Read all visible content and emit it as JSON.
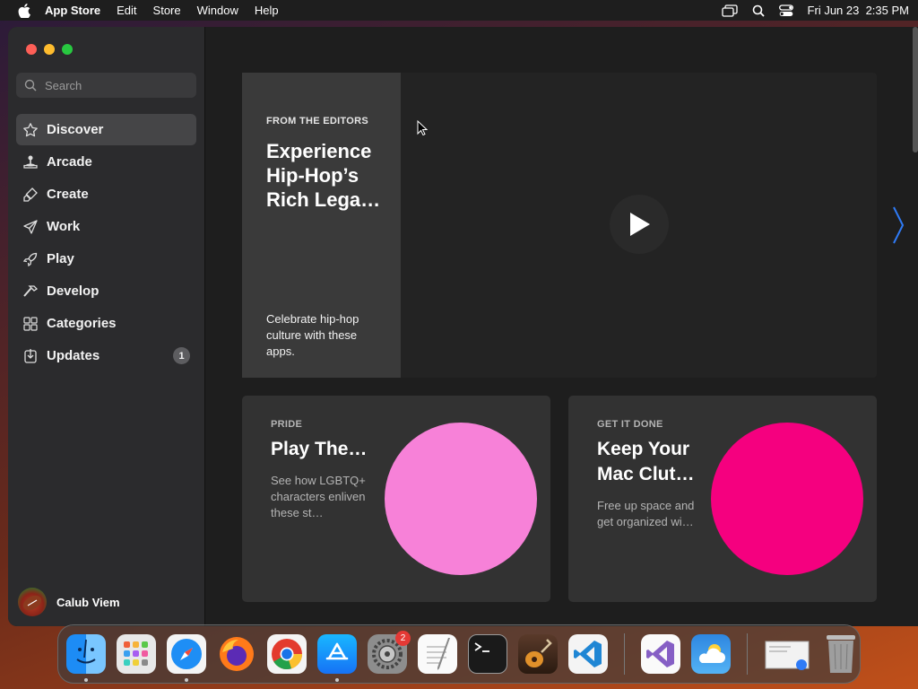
{
  "menubar": {
    "app_name": "App Store",
    "menus": [
      "Edit",
      "Store",
      "Window",
      "Help"
    ],
    "datetime": "Fri Jun 23  2:35 PM",
    "icons": [
      "screen-mirroring-icon",
      "search-icon",
      "control-center-icon"
    ]
  },
  "sidebar": {
    "search_placeholder": "Search",
    "items": [
      {
        "label": "Discover",
        "icon": "star-icon",
        "active": true
      },
      {
        "label": "Arcade",
        "icon": "joystick-icon"
      },
      {
        "label": "Create",
        "icon": "brush-icon"
      },
      {
        "label": "Work",
        "icon": "paper-plane-icon"
      },
      {
        "label": "Play",
        "icon": "rocket-icon"
      },
      {
        "label": "Develop",
        "icon": "hammer-icon"
      },
      {
        "label": "Categories",
        "icon": "grid-icon"
      },
      {
        "label": "Updates",
        "icon": "download-icon",
        "badge": "1"
      }
    ],
    "user_name": "Calub Viem"
  },
  "hero": {
    "eyebrow": "FROM THE EDITORS",
    "title": "Experience Hip-Hop’s Rich Lega…",
    "description": "Celebrate hip-hop culture with these apps."
  },
  "cards": [
    {
      "eyebrow": "PRIDE",
      "title": "Play The…",
      "description": "See how LGBTQ+ characters enliven these st…",
      "color": "#f781d8"
    },
    {
      "eyebrow": "GET IT DONE",
      "title": "Keep Your Mac Clut…",
      "description": "Free up space and get organized wi…",
      "color": "#f5007f"
    }
  ],
  "dock": {
    "settings_badge": "2",
    "apps": [
      "finder-icon",
      "launchpad-icon",
      "safari-icon",
      "firefox-icon",
      "chrome-icon",
      "app-store-icon",
      "system-settings-icon",
      "textedit-icon",
      "terminal-icon",
      "garageband-icon",
      "vscode-icon",
      "visual-studio-icon",
      "weather-icon",
      "preview-icon",
      "trash-icon"
    ]
  },
  "colors": {
    "window_bg": "#1e1e1e",
    "sidebar_bg": "#2b2b2d",
    "active_item": "#454547",
    "accent_blue": "#2f7bf6"
  }
}
